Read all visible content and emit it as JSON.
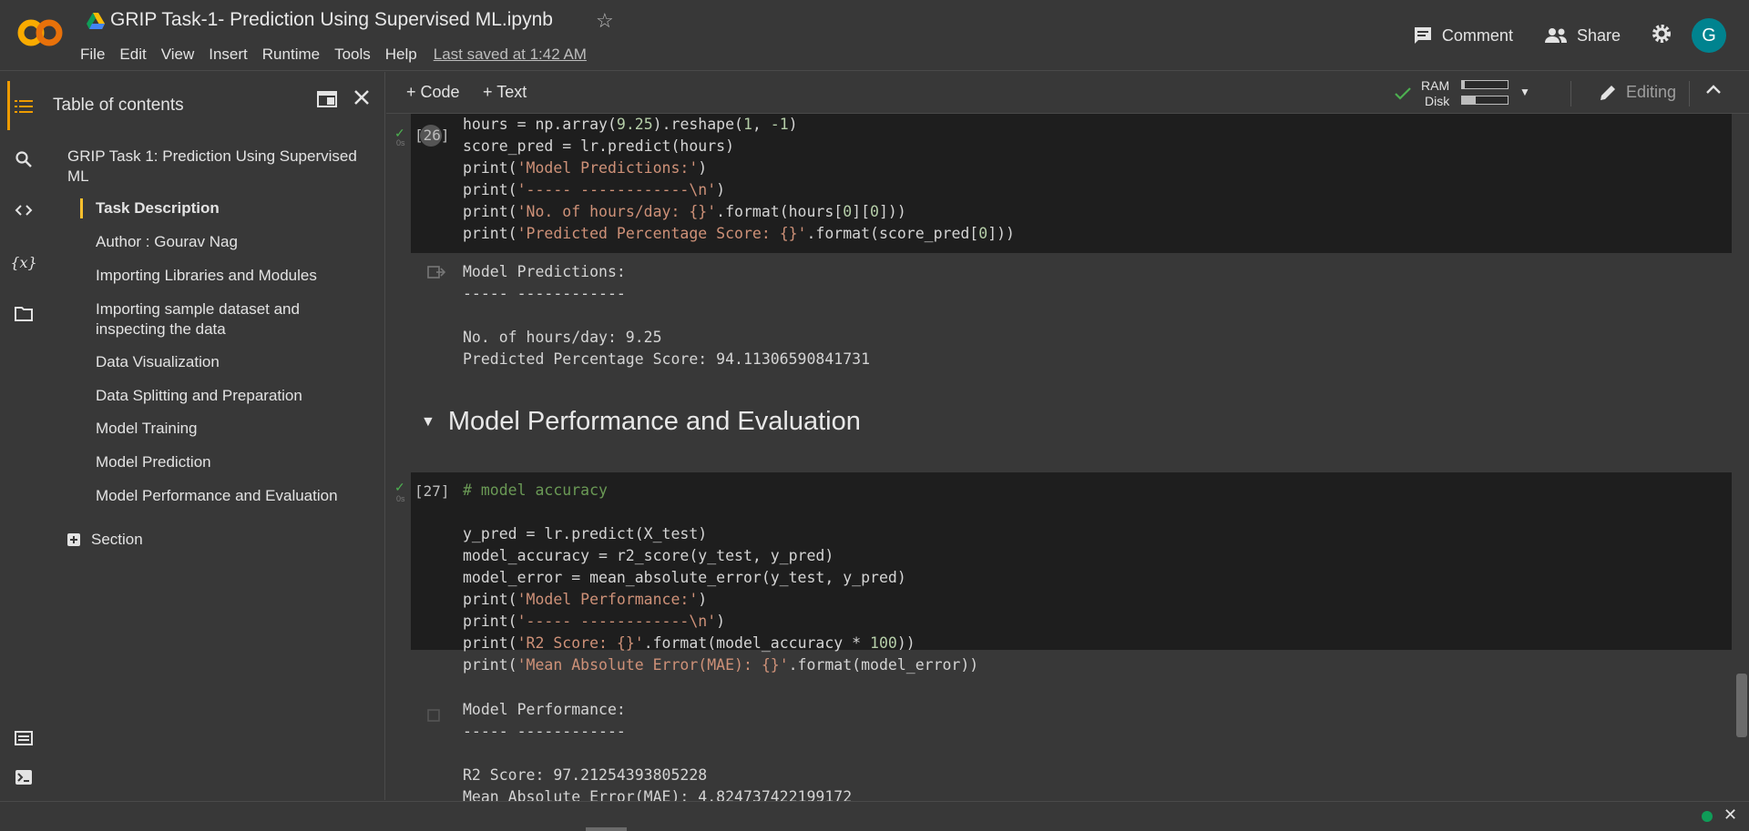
{
  "header": {
    "title": "GRIP Task-1- Prediction Using Supervised ML.ipynb",
    "menu": [
      "File",
      "Edit",
      "View",
      "Insert",
      "Runtime",
      "Tools",
      "Help"
    ],
    "last_saved": "Last saved at 1:42 AM",
    "comment_label": "Comment",
    "share_label": "Share",
    "avatar_letter": "G"
  },
  "toc": {
    "title": "Table of contents",
    "items": [
      "GRIP Task 1: Prediction Using Supervised",
      "ML",
      "Task Description",
      "Author : Gourav Nag",
      "Importing Libraries and Modules",
      "Importing sample dataset and",
      "inspecting the data",
      "Data Visualization",
      "Data Splitting and Preparation",
      "Model Training",
      "Model Prediction",
      "Model Performance and Evaluation"
    ],
    "add_section": "Section"
  },
  "cellbar": {
    "code_label": "+ Code",
    "text_label": "+ Text",
    "ram_label": "RAM",
    "disk_label": "Disk",
    "ram_fraction": 0.05,
    "disk_fraction": 0.3,
    "editing_label": "Editing"
  },
  "cells": {
    "cell26": {
      "number": "[26]",
      "secs": "0s"
    },
    "cell26_output": [
      "Model Predictions:",
      "----- ------------",
      "",
      "No. of hours/day: 9.25",
      "Predicted Percentage Score: 94.11306590841731"
    ],
    "section_heading": "Model Performance and Evaluation",
    "cell27": {
      "number": "[27]",
      "secs": "0s"
    },
    "cell27_output": [
      "Model Performance:",
      "----- ------------",
      "",
      "R2 Score: 97.21254393805228",
      "Mean Absolute Error(MAE): 4.824737422199172"
    ]
  },
  "colors": {
    "accent": "#ee9b00",
    "active_toc": "#fbc02d",
    "avatar": "#00838f",
    "string": "#ce9178",
    "comment": "#6a9955",
    "number": "#b5cea8"
  }
}
